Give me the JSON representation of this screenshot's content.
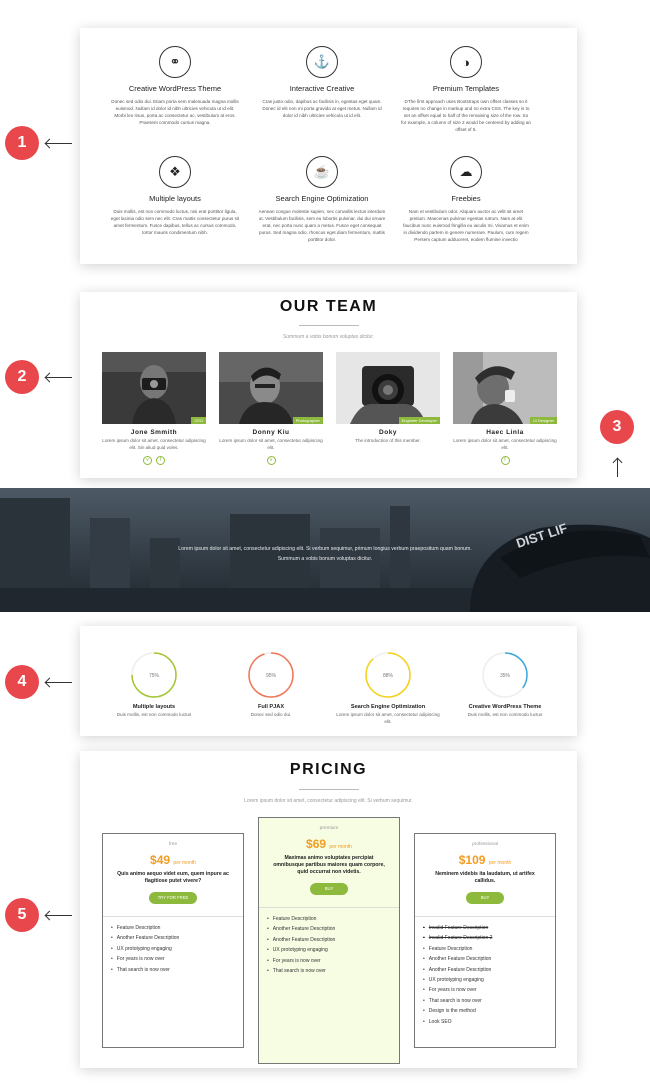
{
  "badges": [
    "1",
    "2",
    "3",
    "4",
    "5"
  ],
  "features": [
    {
      "title": "Creative WordPress Theme",
      "icon": "binoculars-icon",
      "glyph": "⚭",
      "text": "Donec sed odio dui. Etiam porta sem malesuada magna mollis euismod. Nullam id dolor id nibh ultricies vehicula ut id elit. Morbi leo risus, porta ac consectetur ac, vestibulum at eros. Praesent commodo cursus magna."
    },
    {
      "title": "Interactive Creative",
      "icon": "anchor-icon",
      "glyph": "⚓",
      "text": "Cras justo odio, dapibus ac facilisis in, egestas eget quam. Donec id elit non mi porta gravida at eget metus. Nullam id dolor id nibh ultricies vehicula ut id elit."
    },
    {
      "title": "Premium Templates",
      "icon": "contrast-icon",
      "glyph": "◑",
      "text": "DThe first approach uses Bootstraps own offset classes so it requires no change in markup and no extra CSS. The key is to set an offset equal to half of the remaining size of the row. So for example, a column of size 2 would be centered by adding an offset of 5."
    },
    {
      "title": "Multiple layouts",
      "icon": "cubes-icon",
      "glyph": "❖",
      "text": "Duis mollis, est non commodo luctus, nisi erat porttitor ligula, eget lacinia odio sem nec elit. Cras mattis consectetur purus sit amet fermentum. Fusce dapibus, tellus ac cursus commodo, tortor mauris condimentum nibh."
    },
    {
      "title": "Search Engine Optimization",
      "icon": "coffee-cup-icon",
      "glyph": "☕",
      "text": "Aenean congue molestie sapien, nec convallis lectus interdum ut. Vestibulum facilisis, sem eu lobortis pulvinar, dui dui ornare erat, nec porta nunc quam a metus. Fusce eget consequat purus. Sed magna odio, rhoncus eget diam fermentum, mattis porttitor dolor."
    },
    {
      "title": "Freebies",
      "icon": "cloud-download-icon",
      "glyph": "☁",
      "text": "Nam et vestibulum odor. Aliquam auctor ac velit sit amet pretium. Maecenas pulvinar egestas rutrum. Nam at elit faucibus nunc euismod fringilla eu iaculis mi. Vivamus et enim in dividendo partem in genere numerare. Paulum, cum regem Persem captum adduceret, eodem flumine invectio"
    }
  ],
  "team": {
    "title": "OUR TEAM",
    "subtitle": "Summum a vobis bonum voluptas dicitur.",
    "members": [
      {
        "name": "Jone Smmith",
        "role": "CEO",
        "text": "Lorem ipsum dolor sit amet, consectetur adipiscing elit. Sin aliud quid voles.",
        "socials": [
          "v",
          "f"
        ]
      },
      {
        "name": "Donny Kiu",
        "role": "Photographer",
        "text": "Lorem ipsum dolor sit amet, consectetur adipiscing elit.",
        "socials": [
          "v"
        ]
      },
      {
        "name": "Doky",
        "role": "Engineer Developer",
        "text": "The introduction of this member.",
        "socials": []
      },
      {
        "name": "Haec Linla",
        "role": "UI Designer",
        "text": "Lorem ipsum dolor sit amet, consectetur adipiscing elit.",
        "socials": [
          "f"
        ]
      }
    ]
  },
  "banner": {
    "line1": "Lorem ipsum dolor sit amet, consectetur adipiscing elit. Si verbum sequimur, primum longius verbum praepositum quam bonum.",
    "line2": "Summum a vobis bonum voluptas dicitur.",
    "cap_text": "DIST  LIF"
  },
  "skills": [
    {
      "label": "75%",
      "value": 0.75,
      "color": "#a6c735",
      "title": "Multiple layouts",
      "text": "Duis mollis, est non commodo luctus"
    },
    {
      "label": "95%",
      "value": 0.95,
      "color": "#f0785a",
      "title": "Full PJAX",
      "text": "Donec sed odio dui."
    },
    {
      "label": "88%",
      "value": 0.88,
      "color": "#f5d21e",
      "title": "Search Engine Optimization",
      "text": "Lorem ipsum dolor sit amet, consectetur adipiscing elit."
    },
    {
      "label": "35%",
      "value": 0.35,
      "color": "#3fa9dc",
      "title": "Creative WordPress Theme",
      "text": "Duis mollis, est non commodo luctus"
    }
  ],
  "pricing": {
    "title": "PRICING",
    "subtitle": "Lorem ipsum dolor sit amet, consectetur adipiscing elit. Si verbum sequimur.",
    "plans": [
      {
        "tier": "free",
        "price": "$49",
        "per": "per month",
        "desc": "Quis animo aequo videt eum, quem inpure ac flagitiose putet vivere?",
        "button": "TRY FOR FREE",
        "features": [
          "Feature Description",
          "Another Feature Description",
          "UX prototyping engaging",
          "For years is now over",
          "That search is now over"
        ],
        "struck": 0
      },
      {
        "tier": "premium",
        "price": "$69",
        "per": "per month",
        "desc": "Maximas animo voluptates percipiat omnibusque partibus maiores quam corpore, quid occurrat non videtis.",
        "button": "BUY",
        "features": [
          "Feature Description",
          "Another Feature Description",
          "Another Feature Description",
          "UX prototyping engaging",
          "For years is now over",
          "That search is now over"
        ],
        "struck": 0
      },
      {
        "tier": "professional",
        "price": "$109",
        "per": "per month",
        "desc": "Neminem videbis ita laudatum, ut artifex callidus.",
        "button": "BUY",
        "features": [
          "Invalid Feature Description",
          "Invalid Feature Description 2",
          "Feature Description",
          "Another Feature Description",
          "Another Feature Description",
          "UX prototyping engaging",
          "For years is now over",
          "That search is now over",
          "Design is the method",
          "Look SEO"
        ],
        "struck": 2
      }
    ]
  },
  "colors": {
    "accent": "#8dba3c",
    "badge": "#e8474c",
    "price": "#f39c21",
    "premium_bg": "#f6fde3"
  }
}
